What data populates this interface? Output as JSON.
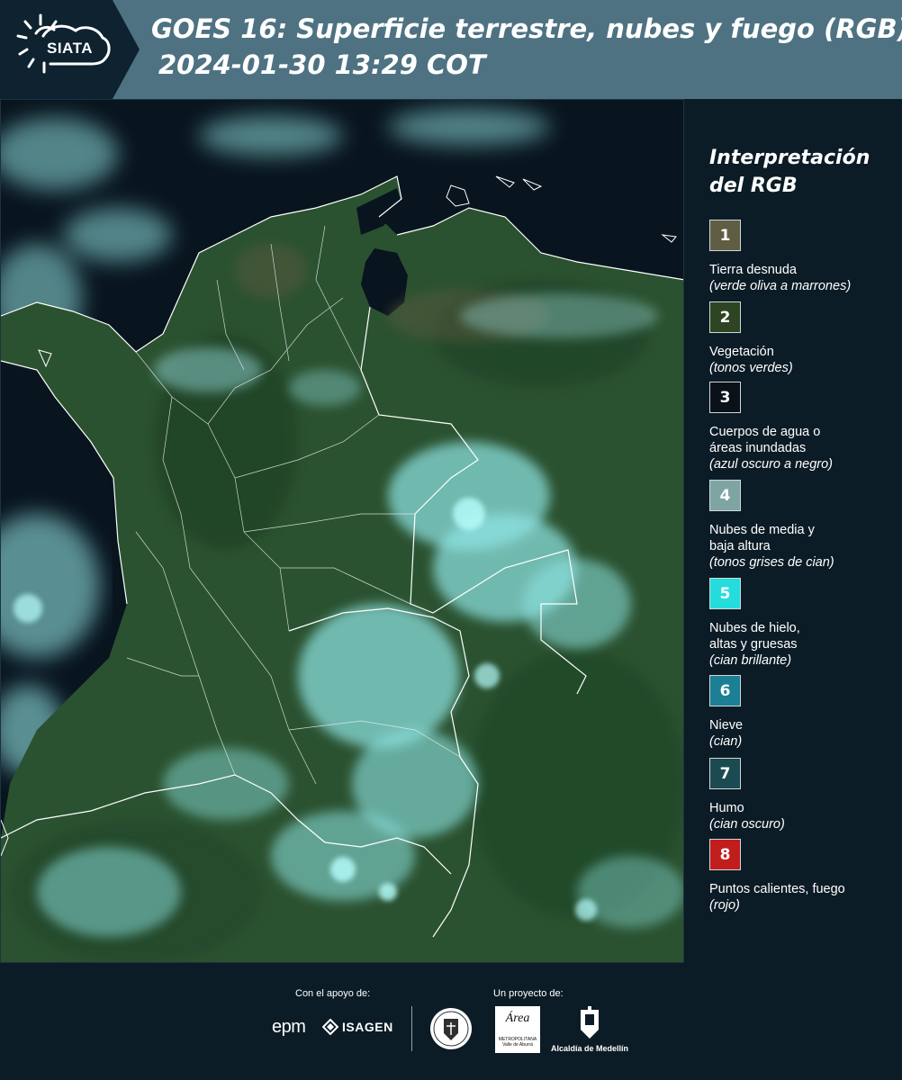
{
  "header": {
    "logo_text": "SIATA",
    "title": "GOES 16: Superficie terrestre, nubes y fuego (RGB)",
    "subtitle": "2024-01-30 13:29 COT"
  },
  "legend": {
    "title_line1": "Interpretación",
    "title_line2": "del RGB",
    "items": [
      {
        "number": "1",
        "color": "#5f5e44",
        "label1": "Tierra desnuda",
        "label2": "",
        "desc": "(verde oliva a marrones)"
      },
      {
        "number": "2",
        "color": "#2e4422",
        "label1": "Vegetación",
        "label2": "",
        "desc": "(tonos verdes)"
      },
      {
        "number": "3",
        "color": "#0a1118",
        "label1": "Cuerpos de agua o",
        "label2": "áreas inundadas",
        "desc": "(azul oscuro a negro)"
      },
      {
        "number": "4",
        "color": "#7ea4a4",
        "label1": "Nubes de media y",
        "label2": "baja altura",
        "desc": "(tonos grises de cian)"
      },
      {
        "number": "5",
        "color": "#25dcdc",
        "label1": "Nubes de hielo,",
        "label2": "altas y gruesas",
        "desc": "(cian brillante)"
      },
      {
        "number": "6",
        "color": "#1c7f93",
        "label1": "Nieve",
        "label2": "",
        "desc": "(cian)"
      },
      {
        "number": "7",
        "color": "#1b4b51",
        "label1": "Humo",
        "label2": "",
        "desc": "(cian oscuro)"
      },
      {
        "number": "8",
        "color": "#c21d1d",
        "label1": "Puntos calientes, fuego",
        "label2": "",
        "desc": "(rojo)"
      }
    ]
  },
  "footer": {
    "support_label": "Con el apoyo de:",
    "project_label": "Un proyecto de:",
    "epm": "epm",
    "isagen": "ISAGEN",
    "area_name": "Área",
    "area_sub": "METROPOLITANA Valle de Aburrá",
    "alcaldia": "Alcaldía de Medellín"
  },
  "map": {
    "ocean_color": "#08141e",
    "land_color": "#2a5230",
    "cloud_color": "#7fe3e3",
    "border_color": "#ffffff"
  }
}
